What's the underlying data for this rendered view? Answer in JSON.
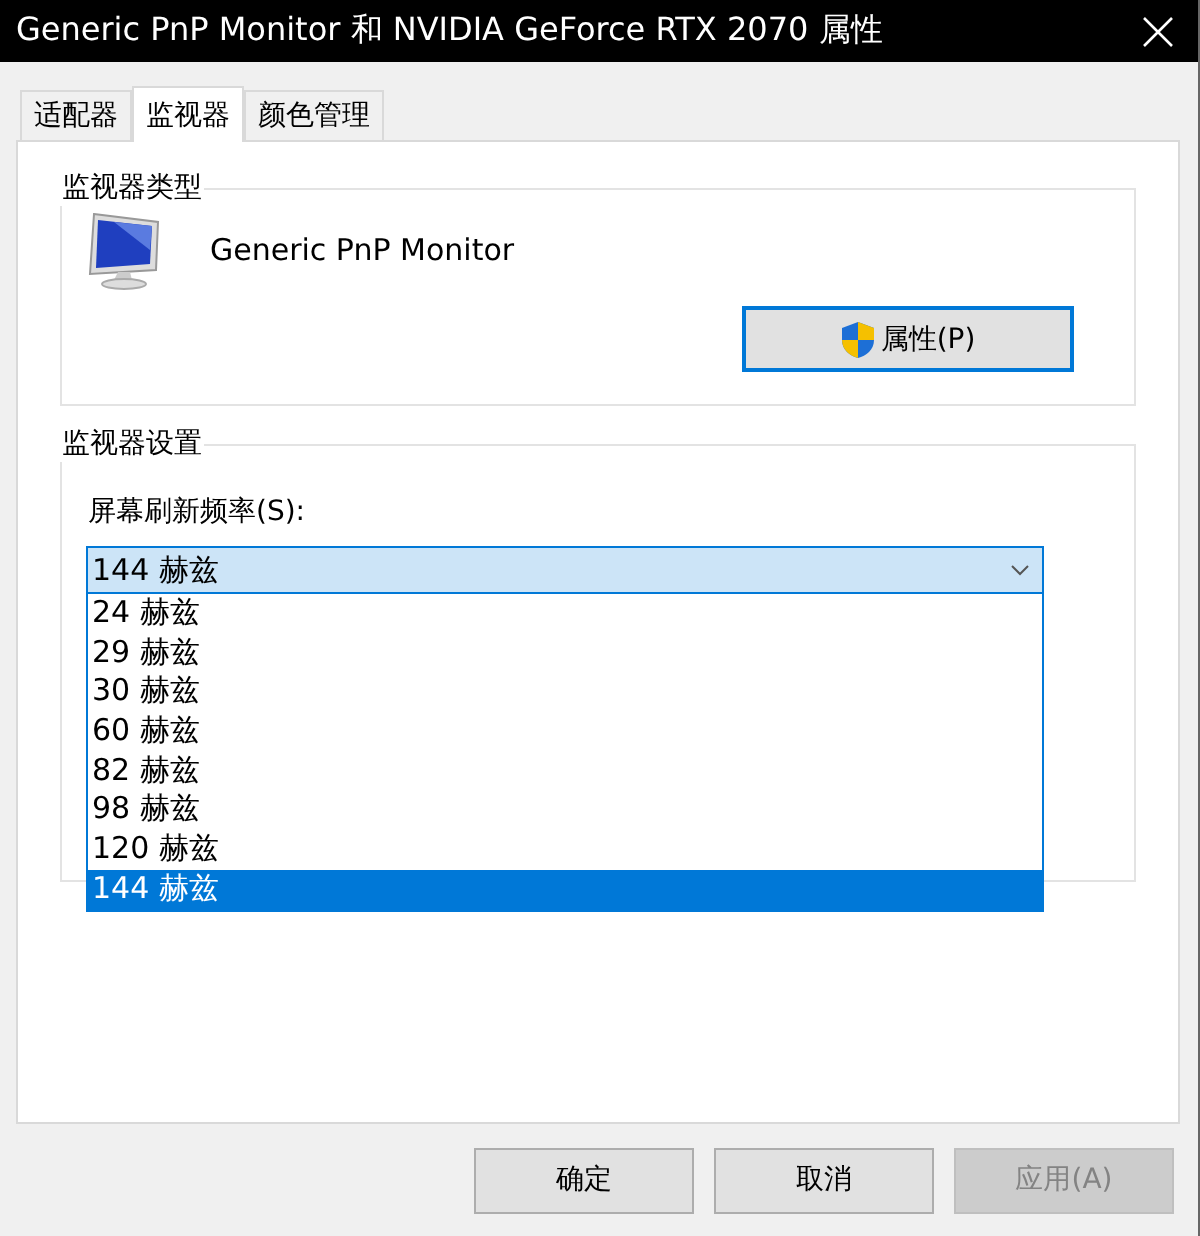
{
  "window": {
    "title": "Generic PnP Monitor 和 NVIDIA GeForce RTX 2070 属性"
  },
  "tabs": [
    {
      "label": "适配器",
      "selected": false
    },
    {
      "label": "监视器",
      "selected": true
    },
    {
      "label": "颜色管理",
      "selected": false
    }
  ],
  "monitor_type": {
    "title": "监视器类型",
    "monitor_name": "Generic PnP Monitor",
    "properties_button": "属性(P)"
  },
  "monitor_settings": {
    "title": "监视器设置",
    "refresh_label": "屏幕刷新频率(S):",
    "dropdown": {
      "value": "144 赫兹",
      "expanded": true,
      "options": [
        {
          "label": "24 赫兹",
          "selected": false
        },
        {
          "label": "29 赫兹",
          "selected": false
        },
        {
          "label": "30 赫兹",
          "selected": false
        },
        {
          "label": "60 赫兹",
          "selected": false
        },
        {
          "label": "82 赫兹",
          "selected": false
        },
        {
          "label": "98 赫兹",
          "selected": false
        },
        {
          "label": "120 赫兹",
          "selected": false
        },
        {
          "label": "144 赫兹",
          "selected": true
        }
      ]
    }
  },
  "buttons": [
    {
      "label": "确定",
      "disabled": false
    },
    {
      "label": "取消",
      "disabled": false
    },
    {
      "label": "应用(A)",
      "disabled": true
    }
  ]
}
